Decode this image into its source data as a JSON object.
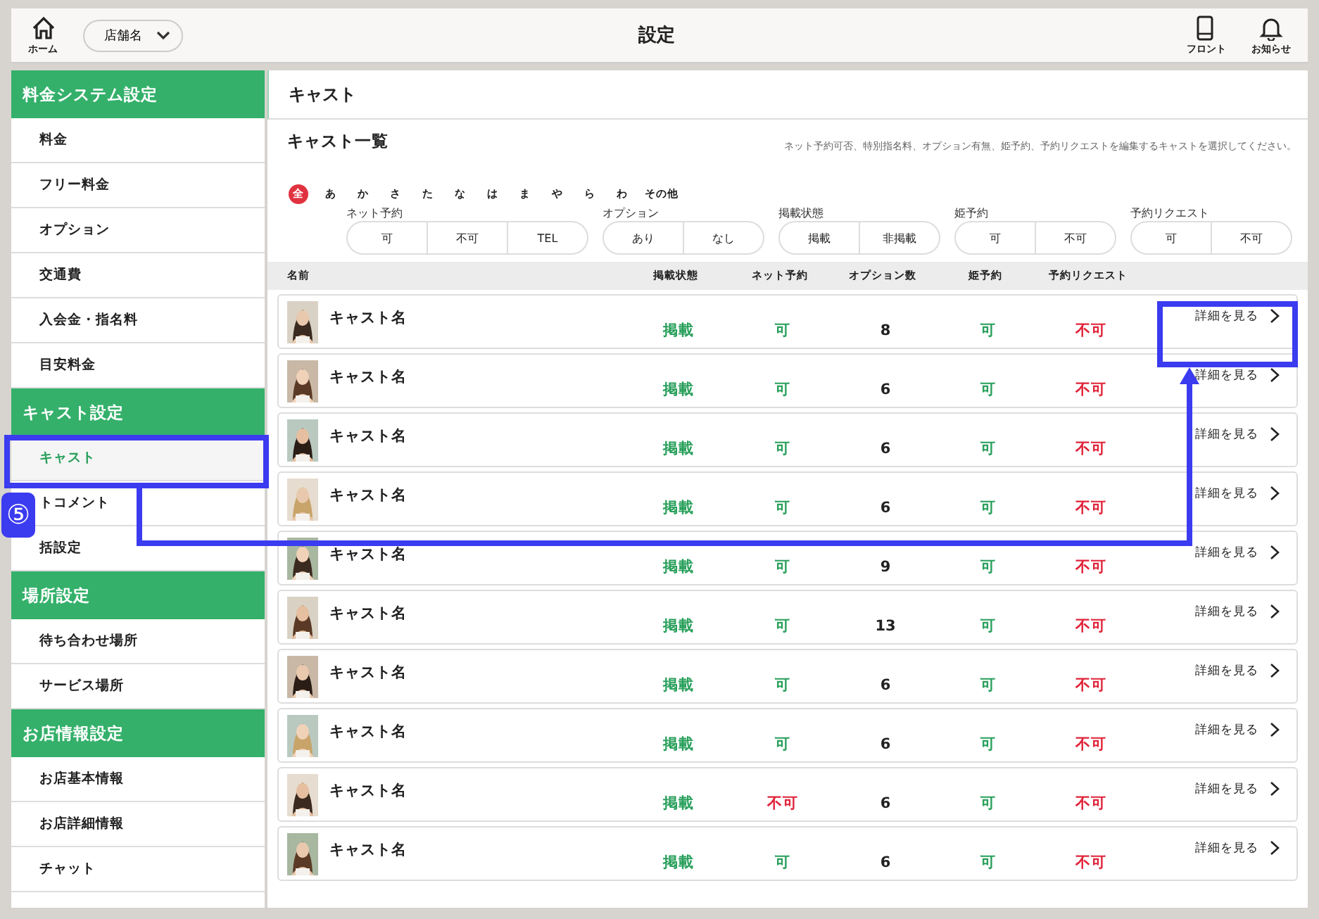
{
  "header": {
    "home_label": "ホーム",
    "store_select": "店舗名",
    "title": "設定",
    "actions": [
      {
        "kind": "phone",
        "label": "フロント"
      },
      {
        "kind": "bell",
        "label": "お知らせ"
      }
    ]
  },
  "sidebar": [
    {
      "heading": "料金システム設定",
      "items": [
        {
          "label": "料金",
          "selected": false
        },
        {
          "label": "フリー料金",
          "selected": false
        },
        {
          "label": "オプション",
          "selected": false
        },
        {
          "label": "交通費",
          "selected": false
        },
        {
          "label": "入会金・指名料",
          "selected": false
        },
        {
          "label": "目安料金",
          "selected": false
        }
      ]
    },
    {
      "heading": "キャスト設定",
      "items": [
        {
          "label": "キャスト",
          "selected": true
        },
        {
          "label": "トコメント",
          "selected": false
        },
        {
          "label": "括設定",
          "selected": false
        }
      ]
    },
    {
      "heading": "場所設定",
      "items": [
        {
          "label": "待ち合わせ場所",
          "selected": false
        },
        {
          "label": "サービス場所",
          "selected": false
        }
      ]
    },
    {
      "heading": "お店情報設定",
      "items": [
        {
          "label": "お店基本情報",
          "selected": false
        },
        {
          "label": "お店詳細情報",
          "selected": false
        },
        {
          "label": "チャット",
          "selected": false
        }
      ]
    }
  ],
  "main": {
    "title": "キャスト",
    "list_title": "キャスト一覧",
    "description": "ネット予約可否、特別指名料、オプション有無、姫予約、予約リクエストを編集するキャストを選択してください。",
    "kana": [
      {
        "label": "全",
        "selected": true
      },
      {
        "label": "あ",
        "selected": false
      },
      {
        "label": "か",
        "selected": false
      },
      {
        "label": "さ",
        "selected": false
      },
      {
        "label": "た",
        "selected": false
      },
      {
        "label": "な",
        "selected": false
      },
      {
        "label": "は",
        "selected": false
      },
      {
        "label": "ま",
        "selected": false
      },
      {
        "label": "や",
        "selected": false
      },
      {
        "label": "ら",
        "selected": false
      },
      {
        "label": "わ",
        "selected": false
      },
      {
        "label": "その他",
        "selected": false
      }
    ],
    "filters": [
      {
        "label": "ネット予約",
        "options": [
          "可",
          "不可",
          "TEL"
        ]
      },
      {
        "label": "オプション",
        "options": [
          "あり",
          "なし"
        ]
      },
      {
        "label": "掲載状態",
        "options": [
          "掲載",
          "非掲載"
        ]
      },
      {
        "label": "姫予約",
        "options": [
          "可",
          "不可"
        ]
      },
      {
        "label": "予約リクエスト",
        "options": [
          "可",
          "不可"
        ]
      }
    ],
    "table": {
      "columns": [
        "名前",
        "掲載状態",
        "ネット予約",
        "オプション数",
        "姫予約",
        "予約リクエスト"
      ],
      "rows": [
        {
          "name": "キャスト名",
          "status": {
            "text": "掲載",
            "ok": true
          },
          "net": {
            "text": "可",
            "ok": true
          },
          "options": "8",
          "hime": {
            "text": "可",
            "ok": true
          },
          "request": {
            "text": "不可",
            "ok": false
          },
          "detail": "詳細を見る"
        },
        {
          "name": "キャスト名",
          "status": {
            "text": "掲載",
            "ok": true
          },
          "net": {
            "text": "可",
            "ok": true
          },
          "options": "6",
          "hime": {
            "text": "可",
            "ok": true
          },
          "request": {
            "text": "不可",
            "ok": false
          },
          "detail": "詳細を見る"
        },
        {
          "name": "キャスト名",
          "status": {
            "text": "掲載",
            "ok": true
          },
          "net": {
            "text": "可",
            "ok": true
          },
          "options": "6",
          "hime": {
            "text": "可",
            "ok": true
          },
          "request": {
            "text": "不可",
            "ok": false
          },
          "detail": "詳細を見る"
        },
        {
          "name": "キャスト名",
          "status": {
            "text": "掲載",
            "ok": true
          },
          "net": {
            "text": "可",
            "ok": true
          },
          "options": "6",
          "hime": {
            "text": "可",
            "ok": true
          },
          "request": {
            "text": "不可",
            "ok": false
          },
          "detail": "詳細を見る"
        },
        {
          "name": "キャスト名",
          "status": {
            "text": "掲載",
            "ok": true
          },
          "net": {
            "text": "可",
            "ok": true
          },
          "options": "9",
          "hime": {
            "text": "可",
            "ok": true
          },
          "request": {
            "text": "不可",
            "ok": false
          },
          "detail": "詳細を見る"
        },
        {
          "name": "キャスト名",
          "status": {
            "text": "掲載",
            "ok": true
          },
          "net": {
            "text": "可",
            "ok": true
          },
          "options": "13",
          "hime": {
            "text": "可",
            "ok": true
          },
          "request": {
            "text": "不可",
            "ok": false
          },
          "detail": "詳細を見る"
        },
        {
          "name": "キャスト名",
          "status": {
            "text": "掲載",
            "ok": true
          },
          "net": {
            "text": "可",
            "ok": true
          },
          "options": "6",
          "hime": {
            "text": "可",
            "ok": true
          },
          "request": {
            "text": "不可",
            "ok": false
          },
          "detail": "詳細を見る"
        },
        {
          "name": "キャスト名",
          "status": {
            "text": "掲載",
            "ok": true
          },
          "net": {
            "text": "可",
            "ok": true
          },
          "options": "6",
          "hime": {
            "text": "可",
            "ok": true
          },
          "request": {
            "text": "不可",
            "ok": false
          },
          "detail": "詳細を見る"
        },
        {
          "name": "キャスト名",
          "status": {
            "text": "掲載",
            "ok": true
          },
          "net": {
            "text": "不可",
            "ok": false
          },
          "options": "6",
          "hime": {
            "text": "可",
            "ok": true
          },
          "request": {
            "text": "不可",
            "ok": false
          },
          "detail": "詳細を見る"
        },
        {
          "name": "キャスト名",
          "status": {
            "text": "掲載",
            "ok": true
          },
          "net": {
            "text": "可",
            "ok": true
          },
          "options": "6",
          "hime": {
            "text": "可",
            "ok": true
          },
          "request": {
            "text": "不可",
            "ok": false
          },
          "detail": "詳細を見る"
        }
      ]
    }
  },
  "annotation": {
    "badge": "⑤"
  }
}
